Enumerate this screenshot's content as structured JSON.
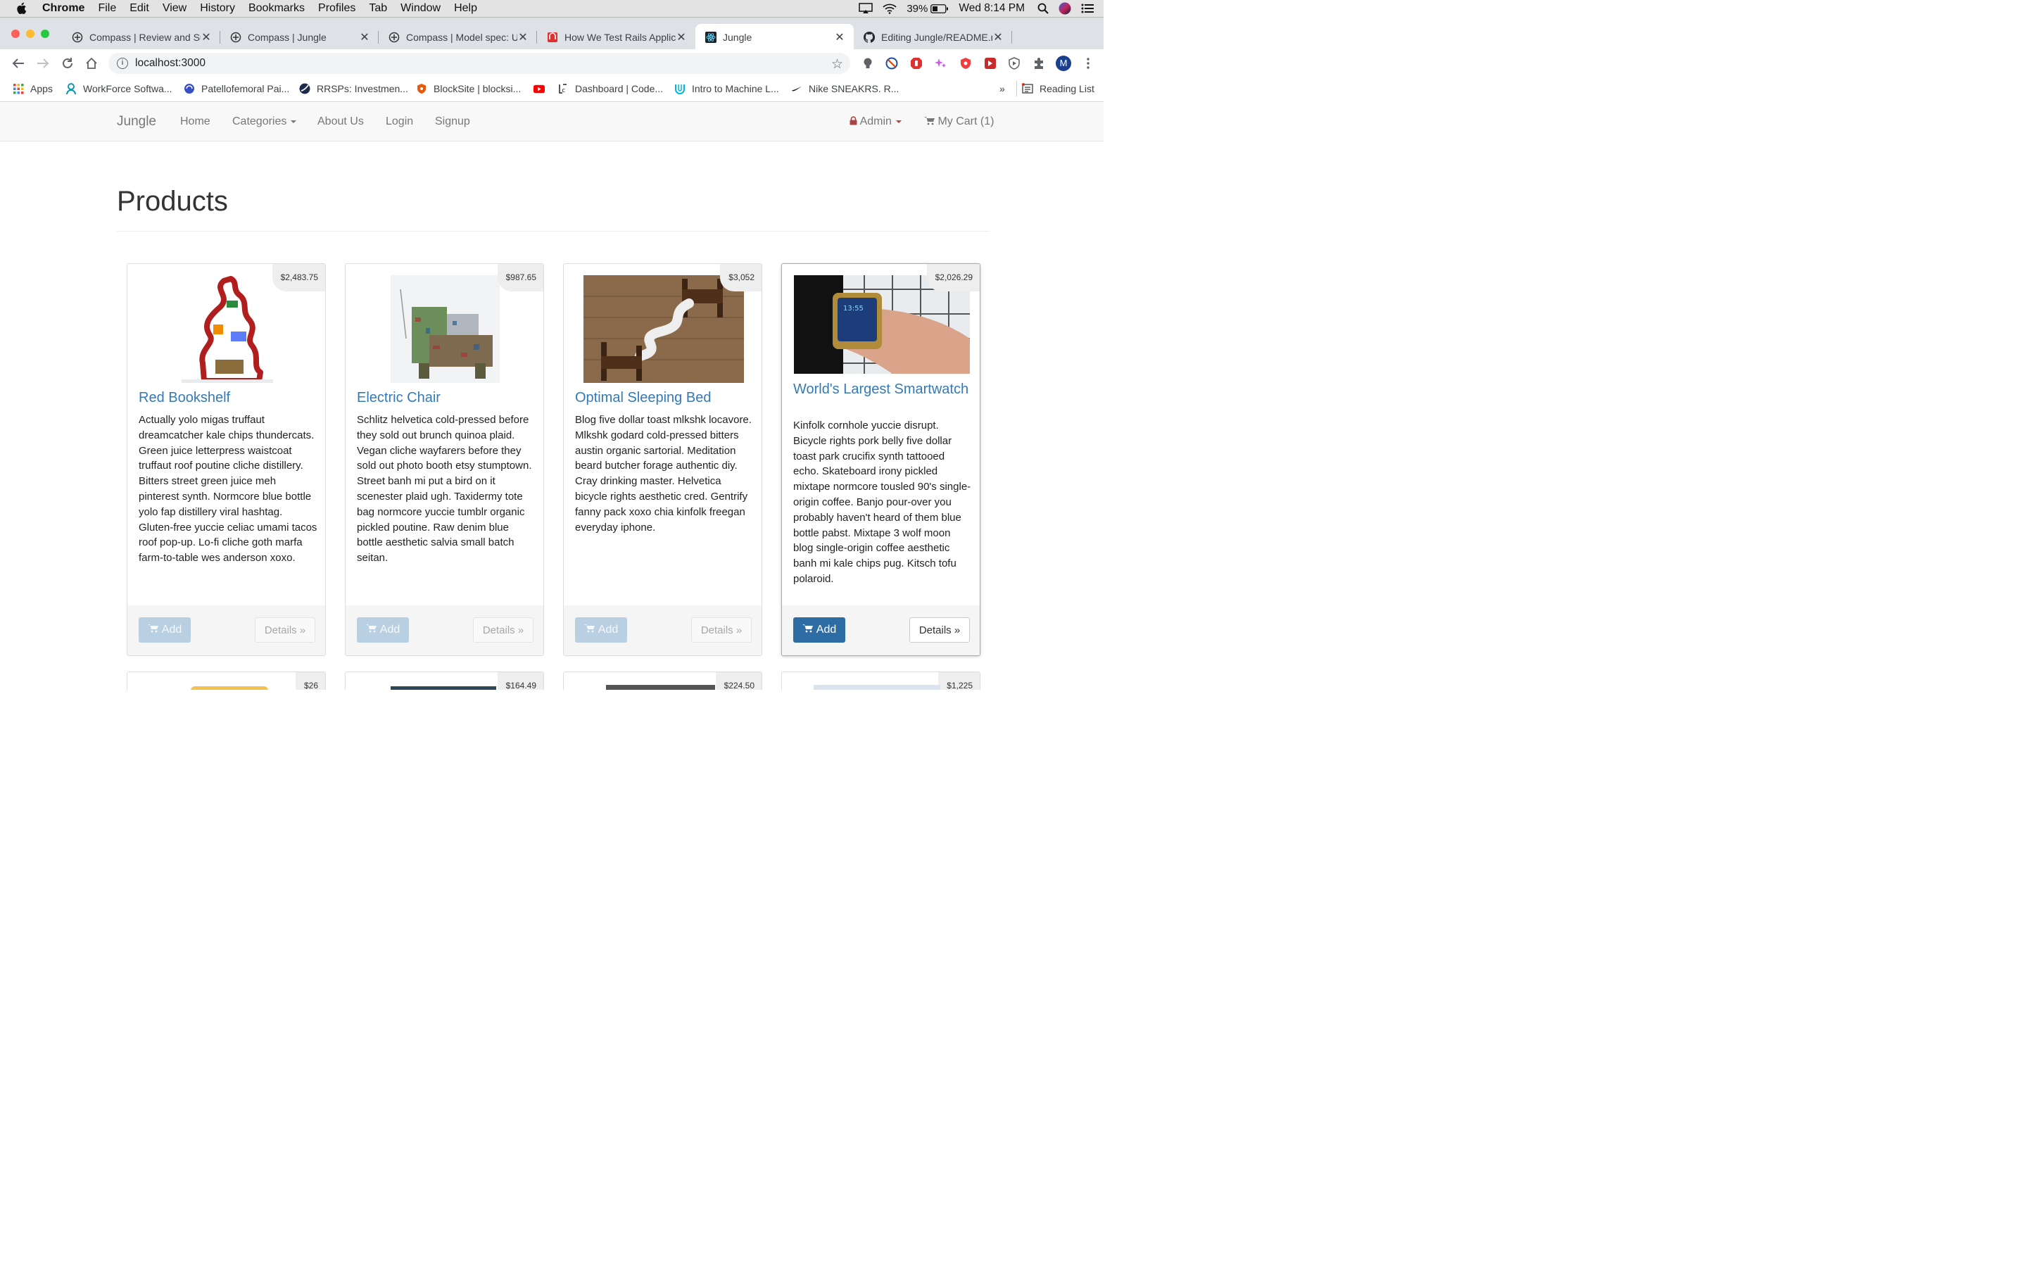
{
  "menubar": {
    "app": "Chrome",
    "items": [
      "File",
      "Edit",
      "View",
      "History",
      "Bookmarks",
      "Profiles",
      "Tab",
      "Window",
      "Help"
    ],
    "battery": "39%",
    "clock": "Wed 8:14 PM"
  },
  "tabs": [
    {
      "title": "Compass | Review and Su",
      "active": false
    },
    {
      "title": "Compass | Jungle",
      "active": false
    },
    {
      "title": "Compass | Model spec: U",
      "active": false
    },
    {
      "title": "How We Test Rails Applic",
      "active": false
    },
    {
      "title": "Jungle",
      "active": true
    },
    {
      "title": "Editing Jungle/README.n",
      "active": false
    }
  ],
  "address": {
    "url": "localhost:3000"
  },
  "bookmarks": {
    "items": [
      "Apps",
      "WorkForce Softwa...",
      "Patellofemoral Pai...",
      "RRSPs: Investmen...",
      "BlockSite | blocksi...",
      "",
      "Dashboard | Code...",
      "Intro to Machine L...",
      "Nike SNEAKRS. R..."
    ],
    "more": "»",
    "reading_list": "Reading List"
  },
  "navbar": {
    "brand": "Jungle",
    "links": [
      "Home",
      "Categories",
      "About Us",
      "Login",
      "Signup"
    ],
    "admin": "Admin",
    "cart": "My Cart (1)"
  },
  "page_title": "Products",
  "products": [
    {
      "name": "Red Bookshelf",
      "price": "$2,483.75",
      "desc": "Actually yolo migas truffaut dreamcatcher kale chips thundercats. Green juice letterpress waistcoat truffaut roof poutine cliche distillery. Bitters street green juice meh pinterest synth. Normcore blue bottle yolo fap distillery viral hashtag. Gluten-free yuccie celiac umami tacos roof pop-up. Lo-fi cliche goth marfa farm-to-table wes anderson xoxo.",
      "add": "Add",
      "details": "Details »"
    },
    {
      "name": "Electric Chair",
      "price": "$987.65",
      "desc": "Schlitz helvetica cold-pressed before they sold out brunch quinoa plaid. Vegan cliche wayfarers before they sold out photo booth etsy stumptown. Street banh mi put a bird on it scenester plaid ugh. Taxidermy tote bag normcore yuccie tumblr organic pickled poutine. Raw denim blue bottle aesthetic salvia small batch seitan.",
      "add": "Add",
      "details": "Details »"
    },
    {
      "name": "Optimal Sleeping Bed",
      "price": "$3,052",
      "desc": "Blog five dollar toast mlkshk locavore. Mlkshk godard cold-pressed bitters austin organic sartorial. Meditation beard butcher forage authentic diy. Cray drinking master. Helvetica bicycle rights aesthetic cred. Gentrify fanny pack xoxo chia kinfolk freegan everyday iphone.",
      "add": "Add",
      "details": "Details »"
    },
    {
      "name": "World's Largest Smartwatch",
      "price": "$2,026.29",
      "desc": "Kinfolk cornhole yuccie disrupt. Bicycle rights pork belly five dollar toast park crucifix synth tattooed echo. Skateboard irony pickled mixtape normcore tousled 90's single-origin coffee. Banjo pour-over you probably haven't heard of them blue bottle pabst. Mixtape 3 wolf moon blog single-origin coffee aesthetic banh mi kale chips pug. Kitsch tofu polaroid.",
      "add": "Add",
      "details": "Details »"
    }
  ],
  "row2_prices": [
    "$26",
    "$164.49",
    "$224.50",
    "$1,225"
  ],
  "colors": {
    "link": "#337ab7",
    "admin": "#a94442",
    "button_primary": "#2e6da4",
    "navbar_bg": "#f8f8f8"
  }
}
